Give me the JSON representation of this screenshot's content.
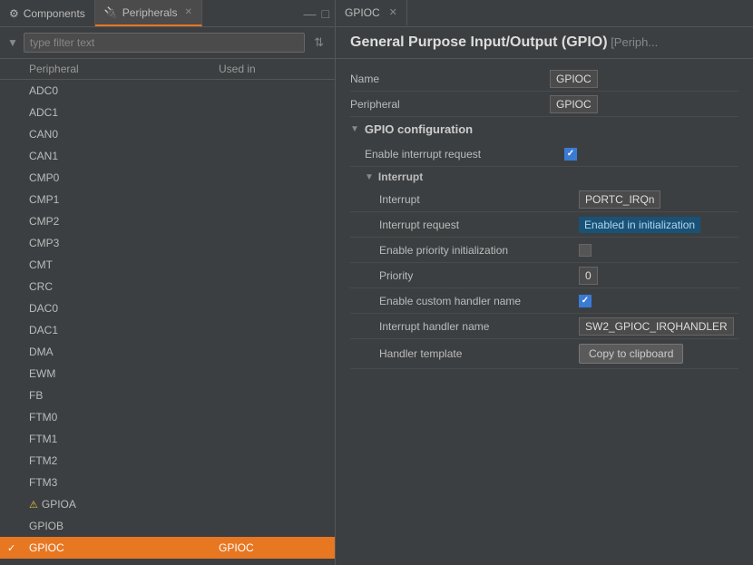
{
  "tabs": {
    "left": [
      {
        "label": "Components",
        "icon": "⚙",
        "active": false,
        "closable": false
      },
      {
        "label": "Peripherals",
        "icon": "🔌",
        "active": true,
        "closable": true
      }
    ],
    "right": [
      {
        "label": "GPIOC",
        "active": true,
        "closable": true
      }
    ]
  },
  "search": {
    "placeholder": "type filter text"
  },
  "table": {
    "col_peripheral": "Peripheral",
    "col_usedin": "Used in"
  },
  "peripherals": [
    {
      "id": "ADC0",
      "name": "ADC0",
      "usedin": "",
      "selected": false,
      "checked": false,
      "warning": false
    },
    {
      "id": "ADC1",
      "name": "ADC1",
      "usedin": "",
      "selected": false,
      "checked": false,
      "warning": false
    },
    {
      "id": "CAN0",
      "name": "CAN0",
      "usedin": "",
      "selected": false,
      "checked": false,
      "warning": false
    },
    {
      "id": "CAN1",
      "name": "CAN1",
      "usedin": "",
      "selected": false,
      "checked": false,
      "warning": false
    },
    {
      "id": "CMP0",
      "name": "CMP0",
      "usedin": "",
      "selected": false,
      "checked": false,
      "warning": false
    },
    {
      "id": "CMP1",
      "name": "CMP1",
      "usedin": "",
      "selected": false,
      "checked": false,
      "warning": false
    },
    {
      "id": "CMP2",
      "name": "CMP2",
      "usedin": "",
      "selected": false,
      "checked": false,
      "warning": false
    },
    {
      "id": "CMP3",
      "name": "CMP3",
      "usedin": "",
      "selected": false,
      "checked": false,
      "warning": false
    },
    {
      "id": "CMT",
      "name": "CMT",
      "usedin": "",
      "selected": false,
      "checked": false,
      "warning": false
    },
    {
      "id": "CRC",
      "name": "CRC",
      "usedin": "",
      "selected": false,
      "checked": false,
      "warning": false
    },
    {
      "id": "DAC0",
      "name": "DAC0",
      "usedin": "",
      "selected": false,
      "checked": false,
      "warning": false
    },
    {
      "id": "DAC1",
      "name": "DAC1",
      "usedin": "",
      "selected": false,
      "checked": false,
      "warning": false
    },
    {
      "id": "DMA",
      "name": "DMA",
      "usedin": "",
      "selected": false,
      "checked": false,
      "warning": false
    },
    {
      "id": "EWM",
      "name": "EWM",
      "usedin": "",
      "selected": false,
      "checked": false,
      "warning": false
    },
    {
      "id": "FB",
      "name": "FB",
      "usedin": "",
      "selected": false,
      "checked": false,
      "warning": false
    },
    {
      "id": "FTM0",
      "name": "FTM0",
      "usedin": "",
      "selected": false,
      "checked": false,
      "warning": false
    },
    {
      "id": "FTM1",
      "name": "FTM1",
      "usedin": "",
      "selected": false,
      "checked": false,
      "warning": false
    },
    {
      "id": "FTM2",
      "name": "FTM2",
      "usedin": "",
      "selected": false,
      "checked": false,
      "warning": false
    },
    {
      "id": "FTM3",
      "name": "FTM3",
      "usedin": "",
      "selected": false,
      "checked": false,
      "warning": false
    },
    {
      "id": "GPIOA",
      "name": "GPIOA",
      "usedin": "",
      "selected": false,
      "checked": false,
      "warning": true
    },
    {
      "id": "GPIOB",
      "name": "GPIOB",
      "usedin": "",
      "selected": false,
      "checked": false,
      "warning": false
    },
    {
      "id": "GPIOC",
      "name": "GPIOC",
      "usedin": "GPIOC",
      "selected": true,
      "checked": true,
      "warning": false
    }
  ],
  "detail": {
    "title": "General Purpose Input/Output (GPIO)",
    "subtitle": "[Periph...",
    "name_label": "Name",
    "name_value": "GPIOC",
    "peripheral_label": "Peripheral",
    "peripheral_value": "GPIOC",
    "gpio_config_label": "GPIO configuration",
    "enable_interrupt_label": "Enable interrupt request",
    "interrupt_section_label": "Interrupt",
    "interrupt_label": "Interrupt",
    "interrupt_value": "PORTC_IRQn",
    "interrupt_request_label": "Interrupt request",
    "interrupt_request_value": "Enabled in initialization",
    "enable_priority_label": "Enable priority initialization",
    "priority_label": "Priority",
    "priority_value": "0",
    "enable_custom_handler_label": "Enable custom handler name",
    "handler_name_label": "Interrupt handler name",
    "handler_name_value": "SW2_GPIOC_IRQHANDLER",
    "handler_template_label": "Handler template",
    "copy_btn_label": "Copy to clipboard"
  }
}
